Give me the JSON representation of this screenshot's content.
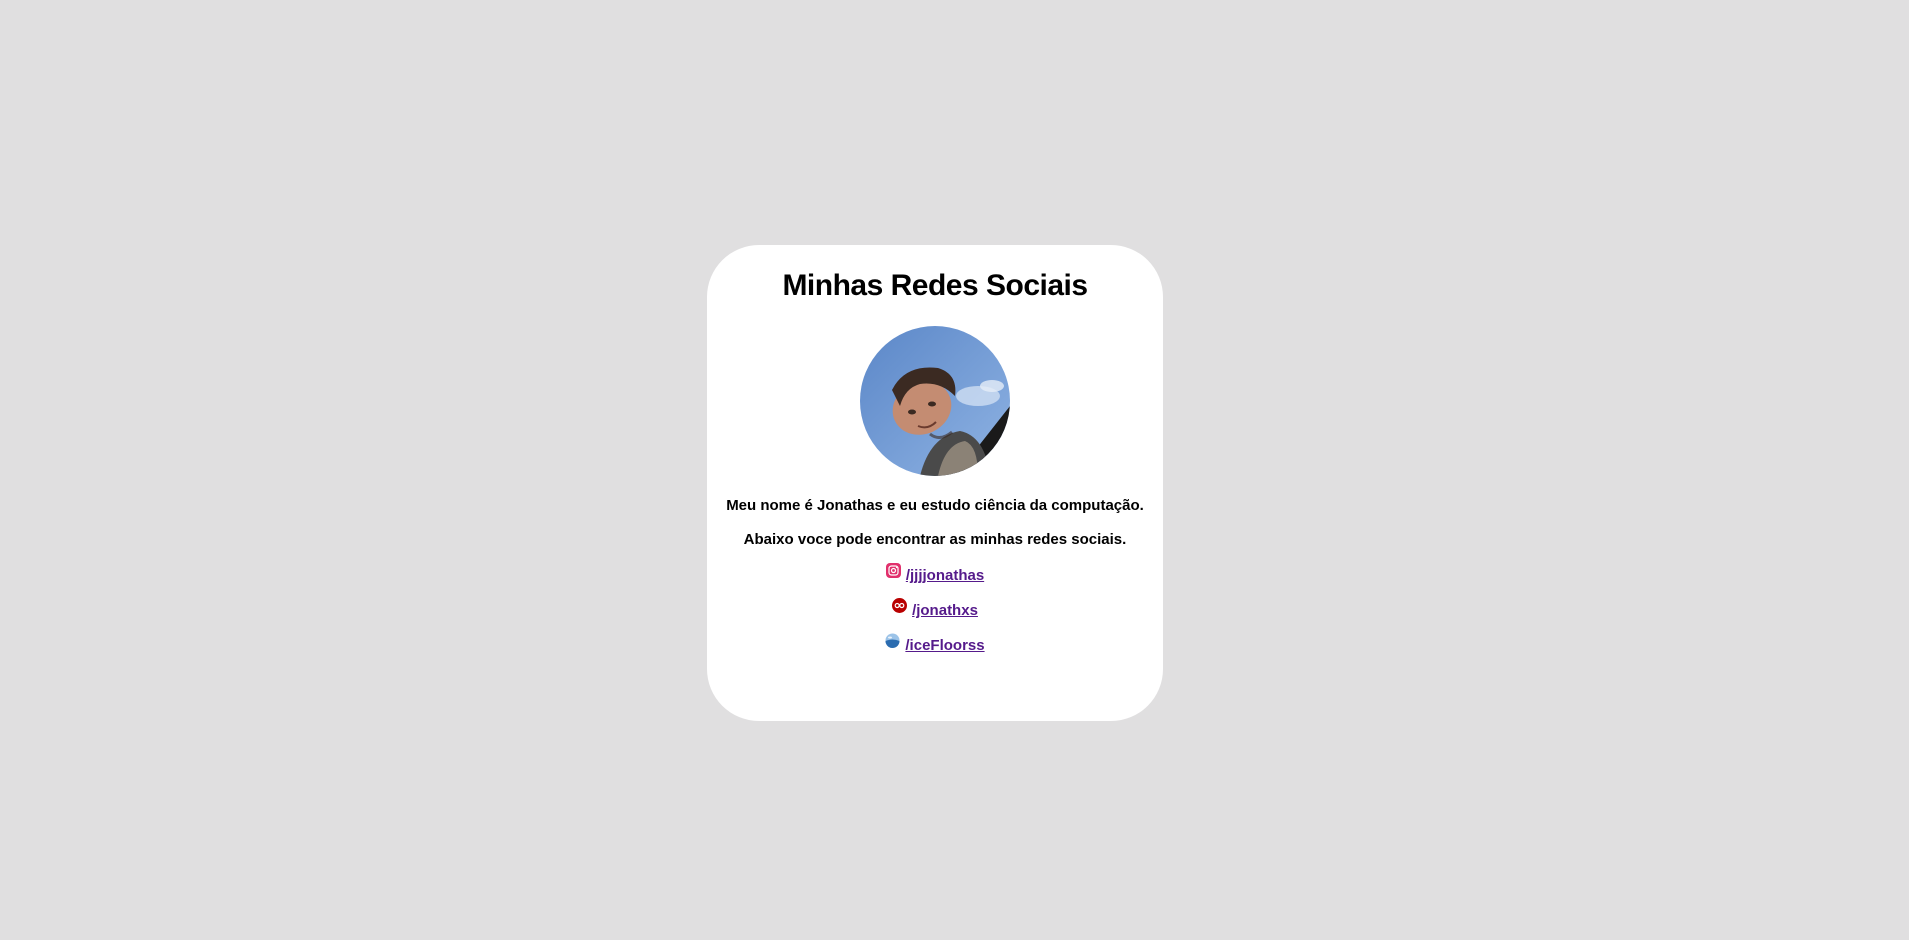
{
  "page": {
    "background": "#e0dfe0",
    "card_background": "#ffffff"
  },
  "card": {
    "title": "Minhas Redes Sociais",
    "avatar": {
      "icon": "profile-photo"
    },
    "bio_line_1": "Meu nome é Jonathas e eu estudo ciência da computação.",
    "bio_line_2": "Abaixo voce pode encontrar as minhas redes sociais.",
    "socials": [
      {
        "icon": "instagram-icon",
        "label": "/jjjjonathas",
        "color": "#e1306c"
      },
      {
        "icon": "lastfm-icon",
        "label": "/jonathxs",
        "color": "#b90000"
      },
      {
        "icon": "osu-icon",
        "label": "/iceFloorss",
        "color": "#2b6cb0"
      }
    ],
    "link_color": "#551a8b"
  }
}
